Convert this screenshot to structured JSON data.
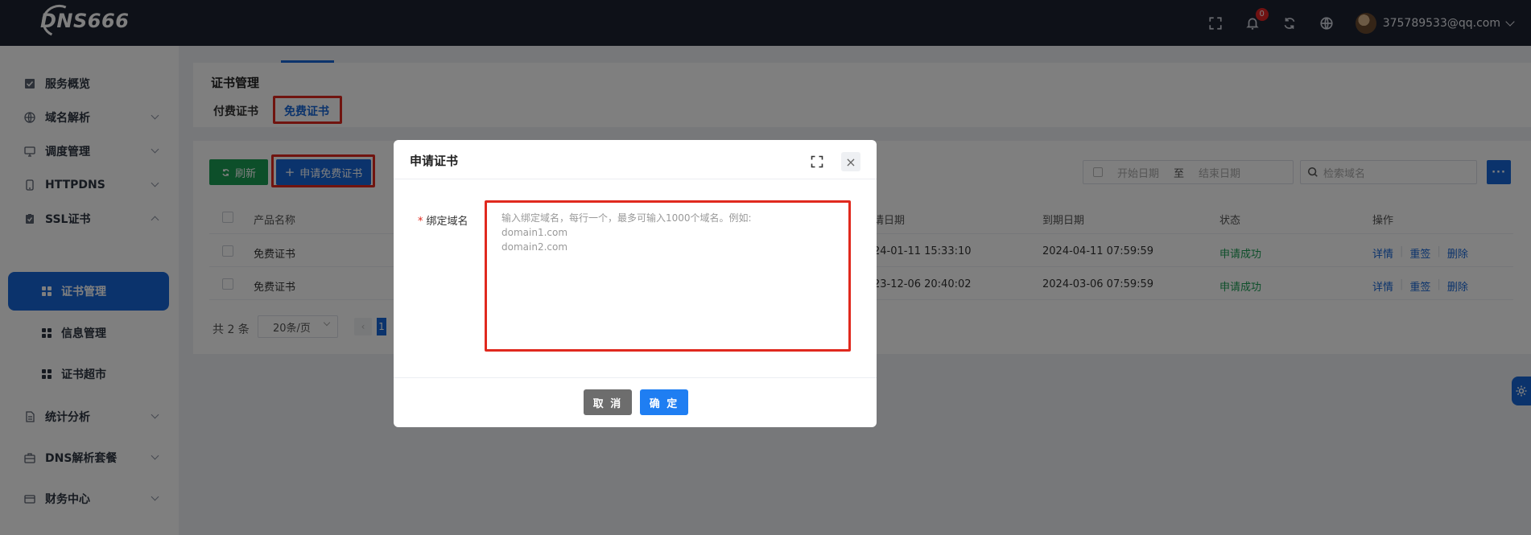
{
  "app": {
    "logo_text": "DNS666"
  },
  "topbar": {
    "notification_count": "0",
    "user_email": "375789533@qq.com"
  },
  "sidebar": {
    "items": [
      {
        "label": "服务概览",
        "icon": "dashboard-icon"
      },
      {
        "label": "域名解析",
        "icon": "globe-icon"
      },
      {
        "label": "调度管理",
        "icon": "monitor-icon"
      },
      {
        "label": "HTTPDNS",
        "icon": "phone-icon"
      },
      {
        "label": "SSL证书",
        "icon": "certificate-icon"
      },
      {
        "label": "统计分析",
        "icon": "document-icon"
      },
      {
        "label": "DNS解析套餐",
        "icon": "package-icon"
      },
      {
        "label": "财务中心",
        "icon": "wallet-icon"
      }
    ],
    "subitems": [
      {
        "label": "证书管理",
        "active": true
      },
      {
        "label": "信息管理",
        "active": false
      },
      {
        "label": "证书超市",
        "active": false
      }
    ]
  },
  "page": {
    "title": "证书管理",
    "tabs": [
      {
        "label": "付费证书",
        "active": false
      },
      {
        "label": "免费证书",
        "active": true
      }
    ]
  },
  "toolbar": {
    "refresh_label": "刷新",
    "apply_label": "申请免费证书",
    "start_date_placeholder": "开始日期",
    "date_separator": "至",
    "end_date_placeholder": "结束日期",
    "search_placeholder": "检索域名",
    "more_label": "···"
  },
  "table": {
    "columns": [
      "产品名称",
      "请日期",
      "到期日期",
      "状态",
      "操作"
    ],
    "rows": [
      {
        "product": "免费证书",
        "apply_date": "24-01-11 15:33:10",
        "expire_date": "2024-04-11 07:59:59",
        "status": "申请成功"
      },
      {
        "product": "免费证书",
        "apply_date": "23-12-06 20:40:02",
        "expire_date": "2024-03-06 07:59:59",
        "status": "申请成功"
      }
    ],
    "actions": [
      "详情",
      "重签",
      "删除"
    ]
  },
  "pager": {
    "total": "共 2 条",
    "page_size": "20条/页",
    "current_page": "1"
  },
  "modal": {
    "title": "申请证书",
    "field_label": "绑定域名",
    "required_mark": "*",
    "textarea_placeholder": "输入绑定域名，每行一个，最多可输入1000个域名。例如:\ndomain1.com\ndomain2.com",
    "cancel_label": "取 消",
    "confirm_label": "确 定",
    "close_symbol": "×"
  },
  "colors": {
    "primary": "#1767d8",
    "success": "#1b9e55",
    "highlight": "#e0291e",
    "topbar": "#1d2230"
  }
}
